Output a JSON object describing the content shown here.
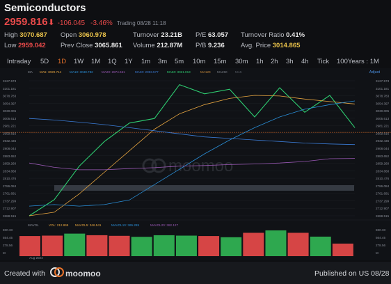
{
  "header": {
    "title": "Semiconductors",
    "price": "2959.816",
    "arrow": "⬇",
    "change": "-106.045",
    "change_pct": "-3.46%",
    "trading": "Trading 08/28 11:18"
  },
  "stats": {
    "high_label": "High",
    "high": "3070.687",
    "low_label": "Low",
    "low": "2959.042",
    "open_label": "Open",
    "open": "3060.978",
    "prev_close_label": "Prev Close",
    "prev_close": "3065.861",
    "turnover_label": "Turnover",
    "turnover": "23.21B",
    "volume_label": "Volume",
    "volume": "212.87M",
    "pe_label": "P/E",
    "pe": "63.057",
    "pb_label": "P/B",
    "pb": "9.236",
    "turnover_ratio_label": "Turnover Ratio",
    "turnover_ratio": "0.41%",
    "avg_price_label": "Avg. Price",
    "avg_price": "3014.865"
  },
  "tabs": [
    "Intraday",
    "5D",
    "1D",
    "1W",
    "1M",
    "1Q",
    "1Y",
    "1m",
    "3m",
    "5m",
    "10m",
    "15m",
    "30m",
    "1h",
    "2h",
    "3h",
    "4h",
    "Tick",
    "100Years : 1M"
  ],
  "active_tab": "1D",
  "chart": {
    "ma_legend": [
      "MA",
      "MA5: 3029.714",
      "MA10: 3048.782",
      "MA20: 2874.661",
      "MA30: 2993.577",
      "MA60: 3021.013",
      "MA120",
      "MA250",
      "MA5"
    ],
    "adjust_label": "Adjust",
    "vol_legend": [
      "MAVOL",
      "VOL: 212.869",
      "MAVOL5: 346.541",
      "MAVOL10: 365.285",
      "MAVOL20: 382.127"
    ],
    "date_label": "Aug 2024",
    "watermark": "moomoo",
    "y_labels_left": [
      "3127.573",
      "3101.181",
      "3078.783",
      "3054.397",
      "3030.005",
      "3005.613",
      "2981.221",
      "2959.816",
      "2932.436",
      "2908.044",
      "2883.652",
      "2859.260",
      "2834.868",
      "2810.476",
      "2786.084",
      "2761.691",
      "2737.299",
      "2712.907",
      "2688.515"
    ],
    "y_labels_right": [
      "3127.573",
      "3101.181",
      "3078.783",
      "3054.397",
      "3030.005",
      "3005.613",
      "2981.221",
      "2959.816",
      "2932.436",
      "2908.044",
      "2883.652",
      "2859.260",
      "2834.868",
      "2810.476",
      "2786.084",
      "2761.691",
      "2737.299",
      "2712.907",
      "2688.515"
    ],
    "vol_labels_left": [
      "830.33",
      "554.45",
      "278.56",
      "M"
    ],
    "vol_labels_right": [
      "830.33",
      "564.45",
      "278.56",
      "M"
    ],
    "colors": {
      "price": "#2ecc71",
      "ma5": "#e8a640",
      "ma10": "#2a8fd8",
      "ma20": "#9b59b6",
      "ma30": "#3a7bd5",
      "up": "#2ea84f",
      "down": "#d64545",
      "band": "#3a3f47"
    }
  },
  "chart_data": {
    "type": "line",
    "title": "",
    "xlabel": "Aug 2024",
    "ylabel": "",
    "ylim": [
      2688.515,
      3127.573
    ],
    "series": [
      {
        "name": "",
        "values": [
          2688.5,
          2741,
          2850,
          2930,
          2990,
          3005,
          3115,
          3085,
          3100,
          3010,
          3105,
          3025,
          3080,
          2975
        ]
      },
      {
        "name": "MA5: 3029.714",
        "values": [
          2688.5,
          2700,
          2760,
          2830,
          2900,
          2970,
          3020,
          3050,
          3070,
          3080,
          3078,
          3068,
          3060,
          3052
        ]
      },
      {
        "name": "MA10: 3048.782",
        "values": [
          2720,
          2725,
          2720,
          2725,
          2740,
          2790,
          2840,
          2890,
          2935,
          2975,
          3010,
          3035,
          3050,
          3062
        ]
      },
      {
        "name": "MA20: 2874.661",
        "values": [
          2860,
          2846,
          2838,
          2838,
          2842,
          2845,
          2850,
          2852,
          2855,
          2857,
          2860,
          2865,
          2874,
          2875
        ]
      },
      {
        "name": "MA30: 2993.577",
        "values": [
          3005,
          3000,
          2993,
          2985,
          2975,
          2965,
          2955,
          2945,
          2940,
          2935,
          2930,
          2925,
          2922,
          2920
        ]
      }
    ],
    "volume": {
      "labels": [
        "VOL: 212.869"
      ],
      "values": [
        500,
        510,
        560,
        520,
        505,
        480,
        520,
        510,
        500,
        470,
        580,
        640,
        580,
        485,
        312
      ],
      "directions": [
        "down",
        "down",
        "up",
        "down",
        "down",
        "up",
        "up",
        "up",
        "down",
        "up",
        "down",
        "up",
        "down",
        "up",
        "down"
      ]
    }
  },
  "footer": {
    "created_with": "Created with",
    "brand": "moomoo",
    "published": "Published on US 08/28"
  }
}
